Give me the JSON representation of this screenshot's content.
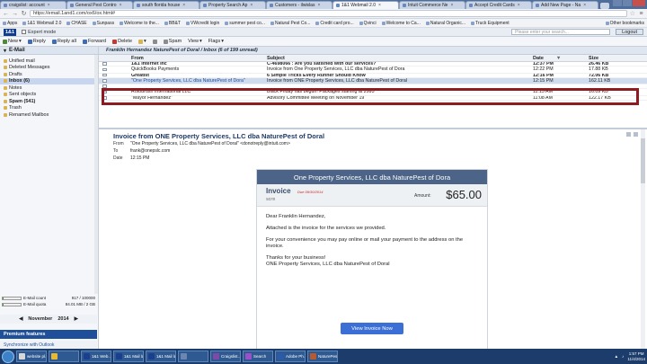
{
  "browser": {
    "tabs": [
      {
        "label": "craigslist: account",
        "active": false
      },
      {
        "label": "General Pest Contro",
        "active": false
      },
      {
        "label": "south florida house",
        "active": false
      },
      {
        "label": "Property Search Ap",
        "active": false
      },
      {
        "label": "Customers - ilwislas",
        "active": false
      },
      {
        "label": "1&1 Webmail 2.0",
        "active": true
      },
      {
        "label": "Intuit Commerce Ne",
        "active": false
      },
      {
        "label": "Accept Credit Cards",
        "active": false
      },
      {
        "label": "Add New Page - Na",
        "active": false
      }
    ],
    "url": "https://email.1and1.com/ox6/ox.html#",
    "bookmarks": [
      "Apps",
      "1&1 Webmail 2.0",
      "CHASE",
      "Sunpass",
      "Welcome to the...",
      "BB&T",
      "VWcredit login",
      "summer pest co...",
      "Natural Pest Co...",
      "Credit card pro...",
      "Qvinci",
      "Welcome to Ca...",
      "Natural Organic...",
      "Truck Equipment"
    ],
    "bookmarks_other": "Other bookmarks"
  },
  "mail_header": {
    "logo": "1&1",
    "expert_mode": "Expert mode",
    "search_placeholder": "Please enter your search...",
    "logout": "Logout"
  },
  "toolbar": {
    "new": "New",
    "reply": "Reply",
    "reply_all": "Reply all",
    "forward": "Forward",
    "delete": "Delete",
    "spam": "Spam",
    "view": "View",
    "flags": "Flags"
  },
  "sidebar": {
    "title": "E-Mail",
    "items": [
      {
        "label": "Unified mail",
        "selected": false,
        "bold": false
      },
      {
        "label": "Deleted Messages",
        "selected": false,
        "bold": false
      },
      {
        "label": "Drafts",
        "selected": false,
        "bold": false
      },
      {
        "label": "Inbox (6)",
        "selected": true,
        "bold": true
      },
      {
        "label": "Notes",
        "selected": false,
        "bold": false
      },
      {
        "label": "Sent objects",
        "selected": false,
        "bold": false
      },
      {
        "label": "Spam (541)",
        "selected": false,
        "bold": true
      },
      {
        "label": "Trash",
        "selected": false,
        "bold": false
      },
      {
        "label": "Renamed Mailbox",
        "selected": false,
        "bold": false
      }
    ],
    "quota": [
      {
        "label": "E-Mail count",
        "value": "917 / 100000",
        "fraction": 0.01
      },
      {
        "label": "E-Mail quota",
        "value": "84.01 MB / 2 GB",
        "fraction": 0.04
      }
    ],
    "calendar_month": "November",
    "calendar_year": "2014",
    "premium": "Premium features",
    "sync": "Synchronize with Outlook"
  },
  "folder_title": "Franklin Hernandez NaturePest of Doral / Inbox (6 of 199 unread)",
  "columns": {
    "from": "From",
    "subject": "Subject",
    "date": "Date",
    "size": "Size"
  },
  "messages": [
    {
      "from": "1&1 Internet Inc",
      "subject": "C-4698066 : Are you satisfied with our services?",
      "date": "12:37 PM",
      "size": "26.46 KB",
      "unread": true,
      "selected": false,
      "cut": true
    },
    {
      "from": "QuickBooks Payments",
      "subject": "Invoice from One Property Services, LLC  dba NaturePest of Dora",
      "date": "12:22 PM",
      "size": "17.88 KB",
      "unread": false,
      "selected": false,
      "cut": false
    },
    {
      "from": "Greatist",
      "subject": "6 Simple Tricks Every Runner Should Know",
      "date": "12:16 PM",
      "size": "72.06 KB",
      "unread": true,
      "selected": false,
      "cut": true
    },
    {
      "from": "\"One Property Services, LLC  dba NaturePest of Dora\"",
      "subject": "Invoice from ONE Property Services, LLC dba NaturePest of Doral",
      "date": "12:15 PM",
      "size": "162.11 KB",
      "unread": false,
      "selected": true,
      "cut": false
    },
    {
      "from": "",
      "subject": "",
      "date": "",
      "size": "",
      "unread": false,
      "selected": false,
      "cut": true
    },
    {
      "from": "Rotobrush International LLC",
      "subject": "Black Friday has begun! Packages starting at 2995",
      "date": "11:15 AM",
      "size": "16.09 KB",
      "unread": false,
      "selected": false,
      "cut": false
    },
    {
      "from": "\"Mayor Hernandez\"",
      "subject": "Advisory Committee Meeting on November 19",
      "date": "11:08 AM",
      "size": "122.17 KB",
      "unread": false,
      "selected": false,
      "cut": true
    }
  ],
  "preview": {
    "subject": "Invoice from ONE Property Services, LLC dba NaturePest of Doral",
    "from_label": "From",
    "from_value": "\"One Property Services, LLC  dba NaturePest of Doral\" <donotreply@intuit.com>",
    "to_label": "To",
    "to_value": "frank@onepslc.com",
    "date_label": "Date",
    "date_value": "12:15 PM"
  },
  "invoice": {
    "banner": "One Property Services, LLC  dba NaturePest of Dora",
    "title": "Invoice",
    "due": "Due 09/30/2014",
    "number": "5078",
    "amount_label": "Amount:",
    "amount": "$65.00",
    "greeting": "Dear Franklin Hernandez,",
    "line1": "Attached is the invoice for the services we provided.",
    "line2": "For your convenience you may pay online or mail your payment to the address on the invoice.",
    "line3": "Thanks for your business!",
    "line4": "ONE Property Services, LLC dba NaturePest of Doral",
    "button": "View Invoice Now"
  },
  "taskbar": {
    "tasks": [
      {
        "label": "website pl...",
        "color": "#d8d8d8"
      },
      {
        "label": "",
        "color": "#e8b830"
      },
      {
        "label": "1&1 Web...",
        "color": "#1a3f8f"
      },
      {
        "label": "1&1 Mail la...",
        "color": "#1a3f8f"
      },
      {
        "label": "1&1 Mail la...",
        "color": "#1a3f8f"
      },
      {
        "label": "",
        "color": "#6b86b2"
      },
      {
        "label": "Craigslist...",
        "color": "#7e4aa8"
      },
      {
        "label": "Search",
        "color": "#9b4fc9"
      },
      {
        "label": "Adobe Ph...",
        "color": "#2b5aa8"
      },
      {
        "label": "NaturePes...",
        "color": "#b85a30"
      }
    ],
    "time": "1:57 PM",
    "date": "11/4/2014",
    "start_color": "#3c82c9"
  }
}
